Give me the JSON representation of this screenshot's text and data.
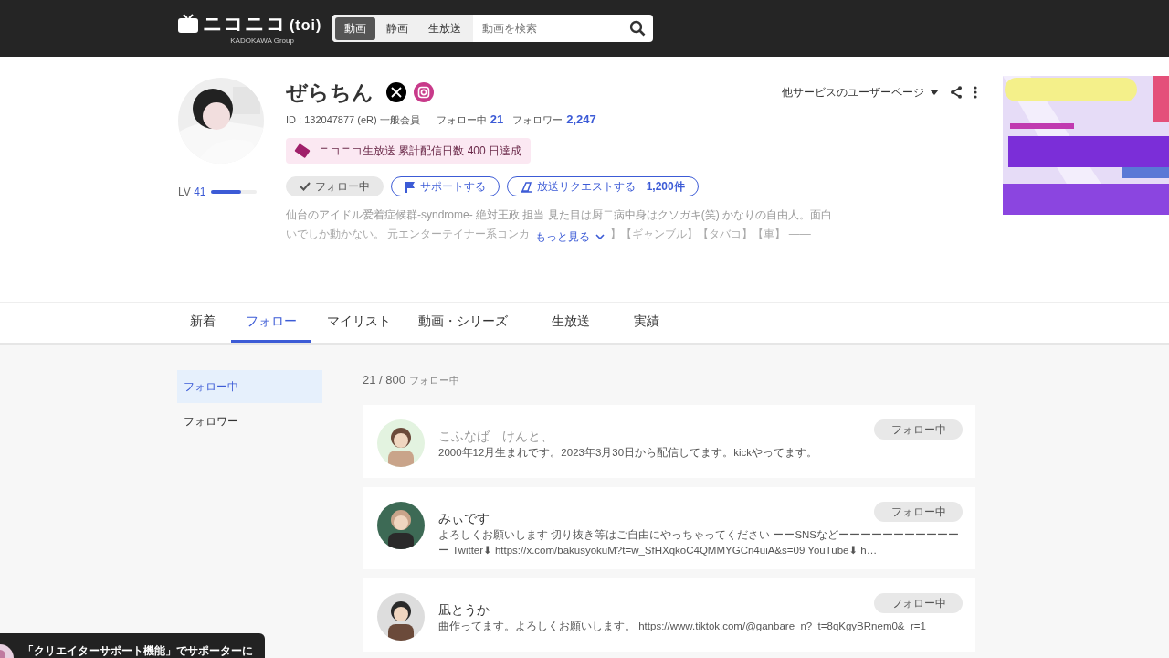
{
  "header": {
    "logo": "ニコニコ",
    "logo_suffix": "(toi)",
    "logo_sub": "KADOKAWA Group",
    "search_tabs": [
      {
        "label": "動画",
        "selected": true
      },
      {
        "label": "静画",
        "selected": false
      },
      {
        "label": "生放送",
        "selected": false
      }
    ],
    "search": {
      "placeholder": "動画を検索"
    }
  },
  "profile": {
    "name": "ぜらちん",
    "id_text": "ID : 132047877 (eR) 一般会員",
    "following_label": "フォロー中",
    "following_count": "21",
    "followers_label": "フォロワー",
    "followers_count": "2,247",
    "badge": "ニコニコ生放送 累計配信日数 400 日達成",
    "level_label": "LV",
    "level_value": "41",
    "level": 0.65,
    "buttons": [
      {
        "kind": "follow",
        "label": "フォロー中"
      },
      {
        "kind": "support",
        "label": "サポートする"
      },
      {
        "kind": "request",
        "label": "放送リクエストする",
        "count": "1,200件"
      }
    ],
    "description": [
      "仙台のアイドル爱着症候群-syndrome- 絶対王政 担当 見た目は厨二病中身はクソガキ(笑) かなりの自由人。面白",
      "いでしか動かない。 元エンターテイナー系コンカ",
      "】【ギャンブル】【タバコ】【車】 ——"
    ],
    "more": "もっと見る",
    "other_services": "他サービスのユーザーページ"
  },
  "tabs": [
    {
      "label": "新着",
      "selected": false
    },
    {
      "label": "フォロー",
      "selected": true
    },
    {
      "label": "マイリスト",
      "selected": false
    },
    {
      "label": "動画・シリーズ",
      "selected": false
    },
    {
      "label": "生放送",
      "selected": false
    },
    {
      "label": "実績",
      "selected": false
    }
  ],
  "sidebar": {
    "items": [
      {
        "label": "フォロー中",
        "selected": true
      },
      {
        "label": "フォロワー",
        "selected": false
      }
    ]
  },
  "list": {
    "count": "21 / 800",
    "count_label": "フォロー中",
    "users": [
      {
        "name": "こふなば　けんと、",
        "dimmed": true,
        "description": "2000年12月生まれです。2023年3月30日から配信してます。kickやってます。",
        "button": "フォロー中"
      },
      {
        "name": "みぃです",
        "dimmed": false,
        "description": "よろしくお願いします 切り抜き等はご自由にやっちゃってください ーーSNSなどーーーーーーーーーーーー Twitter⬇ https://x.com/bakusyokuM?t=w_SfHXqkoC4QMMYGCn4uiA&s=09 YouTube⬇ h…",
        "button": "フォロー中"
      },
      {
        "name": "凪とうか",
        "dimmed": false,
        "description": "曲作ってます。よろしくお願いします。 https://www.tiktok.com/@ganbare_n?_t=8qKgyBRnem0&_r=1",
        "button": "フォロー中"
      }
    ]
  },
  "toast": {
    "text": "「クリエイターサポート機能」でサポーターに"
  }
}
